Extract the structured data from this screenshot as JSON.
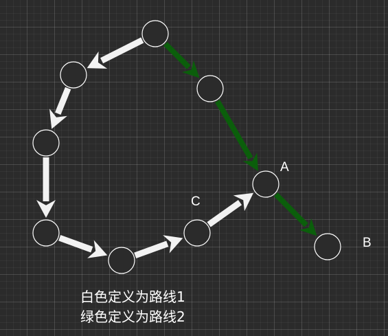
{
  "colors": {
    "background": "#2b2b2b",
    "node_fill": "#2b2b2b",
    "node_stroke": "#ffffff",
    "route1": "#f2f2f2",
    "route2": "#0b5e0b"
  },
  "labels": {
    "A": "A",
    "B": "B",
    "C": "C"
  },
  "legend": {
    "line1": "白色定义为路线1",
    "line2": "绿色定义为路线2"
  },
  "nodes": [
    {
      "id": "start"
    },
    {
      "id": "w1"
    },
    {
      "id": "w2"
    },
    {
      "id": "w3"
    },
    {
      "id": "w4"
    },
    {
      "id": "C"
    },
    {
      "id": "A"
    },
    {
      "id": "g1"
    },
    {
      "id": "B"
    }
  ],
  "routes": [
    {
      "id": "route1",
      "color_key": "route1",
      "path": [
        "start",
        "w1",
        "w2",
        "w3",
        "w4",
        "C",
        "A"
      ]
    },
    {
      "id": "route2",
      "color_key": "route2",
      "path": [
        "start",
        "g1",
        "A",
        "B"
      ]
    }
  ]
}
